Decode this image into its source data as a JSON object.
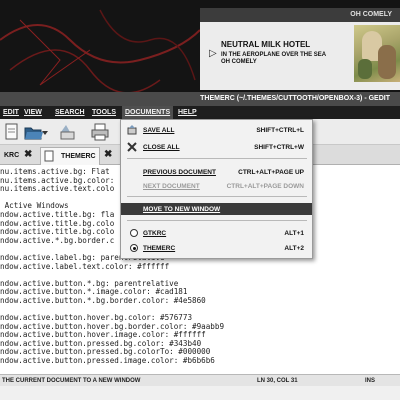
{
  "notification": {
    "app_name": "OH COMELY",
    "artist": "NEUTRAL MILK HOTEL",
    "album": "IN THE AEROPLANE OVER THE SEA",
    "track": "OH COMELY"
  },
  "window": {
    "title": "THEMERC (~/.THEMES/CUTTOOTH/OPENBOX-3) - GEDIT"
  },
  "menubar": {
    "items": [
      "EDIT",
      "VIEW",
      "SEARCH",
      "TOOLS",
      "DOCUMENTS",
      "HELP"
    ]
  },
  "tabs": [
    {
      "label": "KRC"
    },
    {
      "label": "THEMERC"
    }
  ],
  "editor": {
    "lines": [
      "nu.items.active.bg: Flat",
      "nu.items.active.bg.color:",
      "nu.items.active.text.colo",
      "",
      " Active Windows",
      "ndow.active.title.bg: fla",
      "ndow.active.title.bg.colo",
      "ndow.active.title.bg.colo",
      "ndow.active.*.bg.border.c",
      "",
      "ndow.active.label.bg: parentrelative",
      "ndow.active.label.text.color: #ffffff",
      "",
      "ndow.active.button.*.bg: parentrelative",
      "ndow.active.button.*.image.color: #cad181",
      "ndow.active.button.*.bg.border.color: #4e5860",
      "",
      "ndow.active.button.hover.bg.color: #576773",
      "ndow.active.button.hover.bg.border.color: #9aabb9",
      "ndow.active.button.hover.image.color: #ffffff",
      "ndow.active.button.pressed.bg.color: #343b40",
      "ndow.active.button.pressed.bg.colorTo: #000000",
      "ndow.active.button.pressed.image.color: #b6b6b6"
    ]
  },
  "dropdown": {
    "save_all": {
      "label": "SAVE ALL",
      "shortcut": "SHIFT+CTRL+L"
    },
    "close_all": {
      "label": "CLOSE ALL",
      "shortcut": "SHIFT+CTRL+W"
    },
    "previous": {
      "label": "PREVIOUS DOCUMENT",
      "shortcut": "CTRL+ALT+PAGE UP"
    },
    "next": {
      "label": "NEXT DOCUMENT",
      "shortcut": "CTRL+ALT+PAGE DOWN"
    },
    "move": {
      "label": "MOVE TO NEW WINDOW"
    },
    "doc1": {
      "label": "GTKRC",
      "shortcut": "ALT+1"
    },
    "doc2": {
      "label": "THEMERC",
      "shortcut": "ALT+2"
    }
  },
  "statusbar": {
    "message": "THE CURRENT DOCUMENT TO A NEW WINDOW",
    "position": "LN 30, COL 31",
    "mode": "INS"
  },
  "colors": {
    "menubar_bg": "#1e1e1e",
    "highlight": "#3a3a3a",
    "desktop_accent": "#c0392b"
  }
}
